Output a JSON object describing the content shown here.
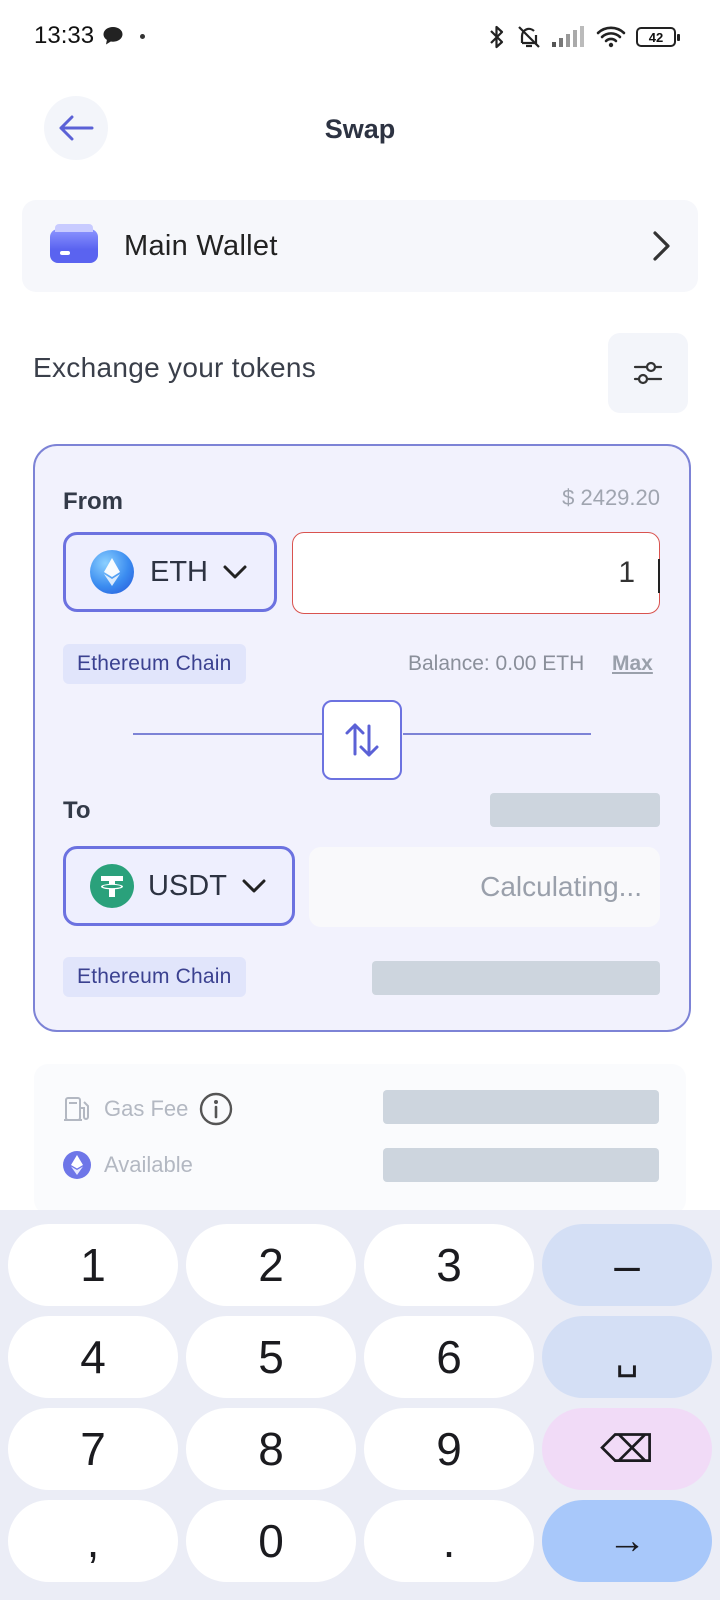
{
  "status_bar": {
    "time": "13:33",
    "battery": "42"
  },
  "header": {
    "title": "Swap"
  },
  "wallet": {
    "name": "Main Wallet"
  },
  "exchange": {
    "label": "Exchange your tokens"
  },
  "swap": {
    "from": {
      "label": "From",
      "usd_value": "$ 2429.20",
      "token": "ETH",
      "amount": "1",
      "chain": "Ethereum Chain",
      "balance": "Balance: 0.00 ETH",
      "max_label": "Max"
    },
    "to": {
      "label": "To",
      "token": "USDT",
      "placeholder": "Calculating...",
      "chain": "Ethereum Chain"
    }
  },
  "fees": {
    "gas_fee_label": "Gas Fee",
    "available_label": "Available"
  },
  "keyboard": {
    "rows": [
      [
        "1",
        "2",
        "3",
        "–"
      ],
      [
        "4",
        "5",
        "6",
        "␣"
      ],
      [
        "7",
        "8",
        "9",
        "⌫"
      ],
      [
        ",",
        "0",
        ".",
        "→"
      ]
    ]
  },
  "colors": {
    "accent": "#6c72e0",
    "card_bg": "#f2f2fd",
    "error_border": "#d9534f",
    "usdt_green": "#2aa17b",
    "skeleton": "#cdd5de"
  },
  "icons": {
    "back": "arrow-left-icon",
    "wallet": "wallet-icon",
    "chevron": "chevron-right-icon",
    "settings": "sliders-icon",
    "swap": "swap-vertical-icon",
    "gas": "fuel-pump-icon",
    "info": "info-icon",
    "eth": "ethereum-icon"
  }
}
